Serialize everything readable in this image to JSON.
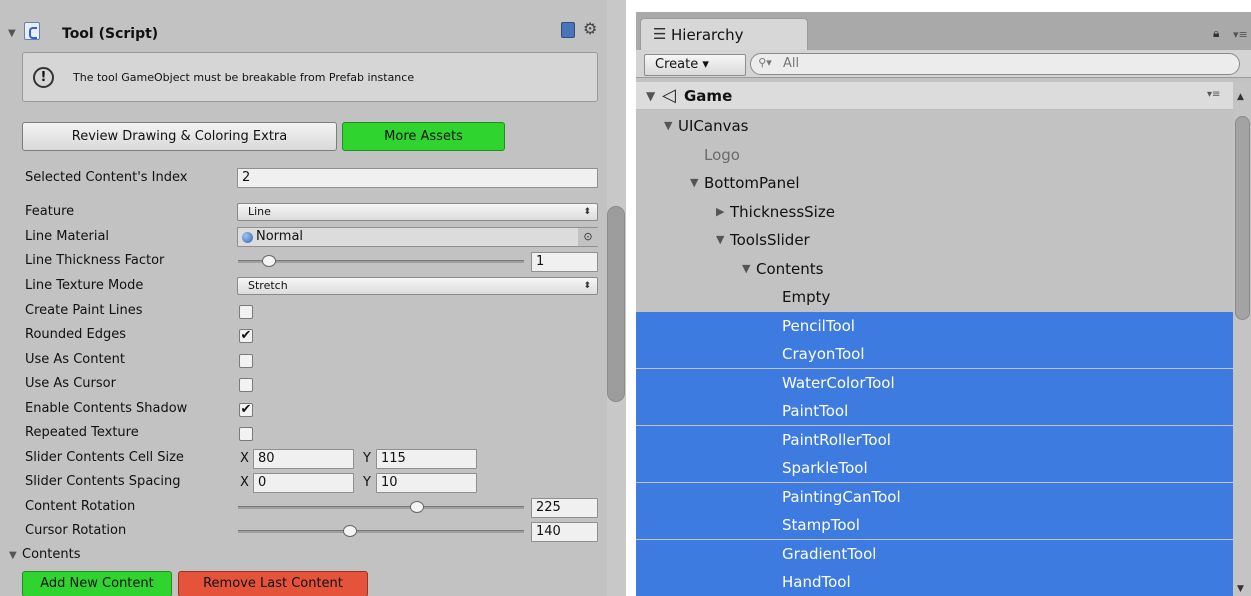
{
  "inspector": {
    "component_title": "Tool (Script)",
    "help_message": "The tool GameObject must be breakable from Prefab instance",
    "buttons": {
      "review": "Review Drawing & Coloring Extra",
      "more_assets": "More Assets",
      "add_content": "Add New Content",
      "remove_content": "Remove Last Content"
    },
    "selected_index": {
      "label": "Selected Content's Index",
      "value": "2"
    },
    "feature": {
      "label": "Feature",
      "value": "Line"
    },
    "line_material": {
      "label": "Line Material",
      "value": "Normal"
    },
    "line_thickness": {
      "label": "Line Thickness Factor",
      "value": "1",
      "slider_fraction": 0.11
    },
    "line_texture_mode": {
      "label": "Line Texture Mode",
      "value": "Stretch"
    },
    "checkboxes": [
      {
        "label": "Create Paint Lines",
        "checked": false
      },
      {
        "label": "Rounded Edges",
        "checked": true
      },
      {
        "label": "Use As Content",
        "checked": false
      },
      {
        "label": "Use As Cursor",
        "checked": false
      },
      {
        "label": "Enable Contents Shadow",
        "checked": true
      },
      {
        "label": "Repeated Texture",
        "checked": false
      }
    ],
    "cell_size": {
      "label": "Slider Contents Cell Size",
      "x_label": "X",
      "x": "80",
      "y_label": "Y",
      "y": "115"
    },
    "spacing": {
      "label": "Slider Contents Spacing",
      "x_label": "X",
      "x": "0",
      "y_label": "Y",
      "y": "10"
    },
    "content_rotation": {
      "label": "Content Rotation",
      "value": "225",
      "slider_fraction": 0.625
    },
    "cursor_rotation": {
      "label": "Cursor Rotation",
      "value": "140",
      "slider_fraction": 0.39
    },
    "contents_foldout": "Contents",
    "checkmark_glyph": "✔"
  },
  "hierarchy": {
    "tab_label": "Hierarchy",
    "create_label": "Create ▾",
    "search_placeholder": "All",
    "scene_name": "Game",
    "rows": [
      {
        "label": "UICanvas",
        "depth": 1,
        "arrow": "▼",
        "selected": false,
        "dim": false
      },
      {
        "label": "Logo",
        "depth": 2,
        "arrow": "",
        "selected": false,
        "dim": true
      },
      {
        "label": "BottomPanel",
        "depth": 2,
        "arrow": "▼",
        "selected": false,
        "dim": false
      },
      {
        "label": "ThicknessSize",
        "depth": 3,
        "arrow": "▶",
        "selected": false,
        "dim": false
      },
      {
        "label": "ToolsSlider",
        "depth": 3,
        "arrow": "▼",
        "selected": false,
        "dim": false
      },
      {
        "label": "Contents",
        "depth": 4,
        "arrow": "▼",
        "selected": false,
        "dim": false
      },
      {
        "label": "Empty",
        "depth": 5,
        "arrow": "",
        "selected": false,
        "dim": false
      },
      {
        "label": "PencilTool",
        "depth": 5,
        "arrow": "",
        "selected": true,
        "dim": false
      },
      {
        "label": "CrayonTool",
        "depth": 5,
        "arrow": "",
        "selected": true,
        "dim": false
      },
      {
        "label": "WaterColorTool",
        "depth": 5,
        "arrow": "",
        "selected": true,
        "dim": false
      },
      {
        "label": "PaintTool",
        "depth": 5,
        "arrow": "",
        "selected": true,
        "dim": false
      },
      {
        "label": "PaintRollerTool",
        "depth": 5,
        "arrow": "",
        "selected": true,
        "dim": false
      },
      {
        "label": "SparkleTool",
        "depth": 5,
        "arrow": "",
        "selected": true,
        "dim": false
      },
      {
        "label": "PaintingCanTool",
        "depth": 5,
        "arrow": "",
        "selected": true,
        "dim": false
      },
      {
        "label": "StampTool",
        "depth": 5,
        "arrow": "",
        "selected": true,
        "dim": false
      },
      {
        "label": "GradientTool",
        "depth": 5,
        "arrow": "",
        "selected": true,
        "dim": false
      },
      {
        "label": "HandTool",
        "depth": 5,
        "arrow": "",
        "selected": true,
        "dim": false
      }
    ]
  }
}
